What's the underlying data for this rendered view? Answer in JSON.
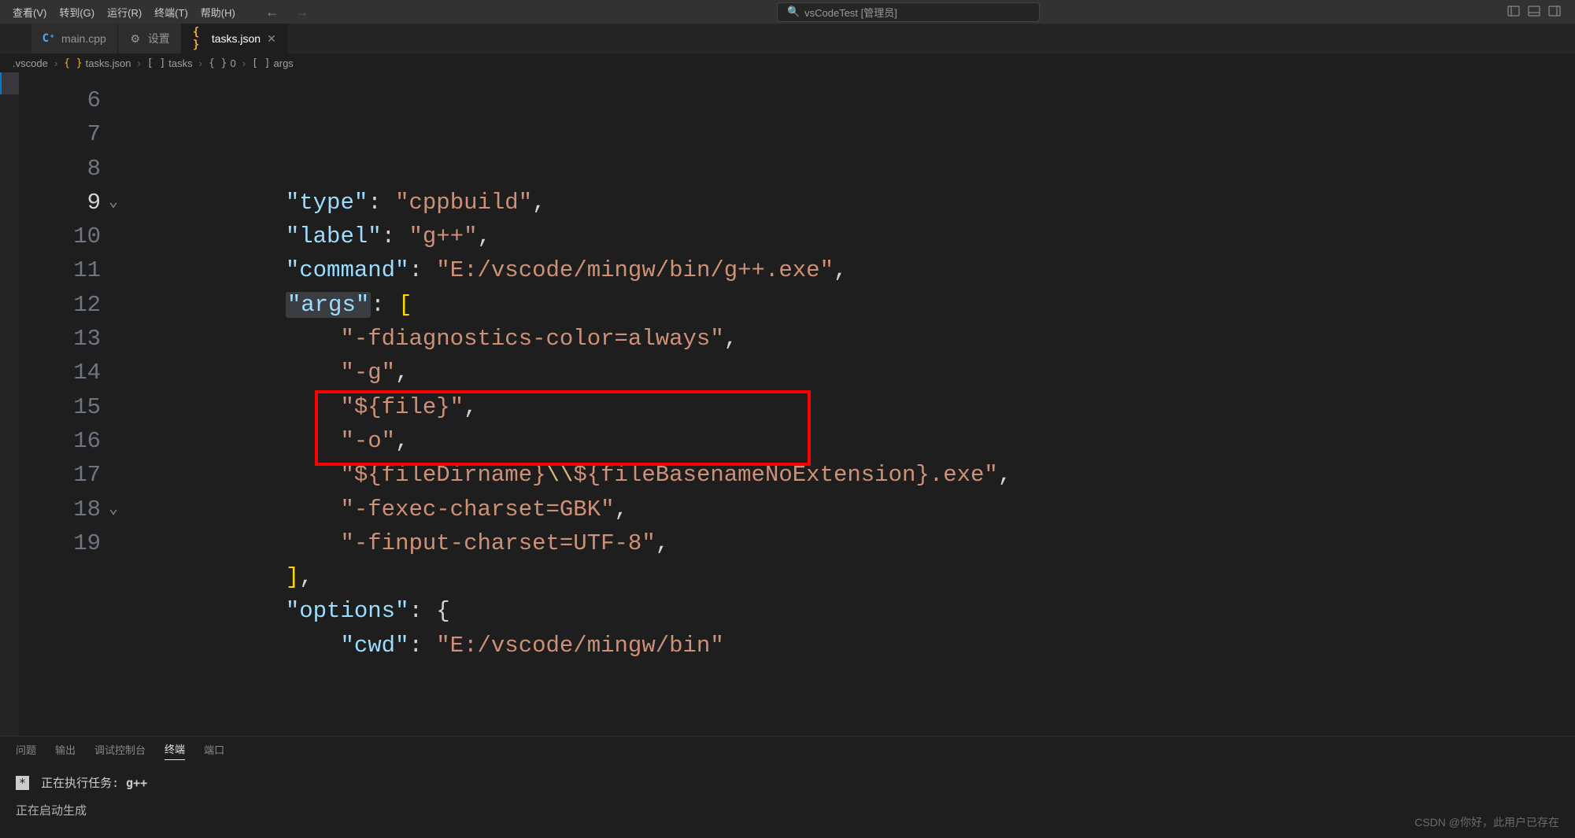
{
  "menubar": {
    "items": [
      "查看(V)",
      "转到(G)",
      "运行(R)",
      "终端(T)",
      "帮助(H)"
    ]
  },
  "search": {
    "placeholder": "vsCodeTest [管理员]"
  },
  "tabs": [
    {
      "icon": "cpp",
      "label": "main.cpp",
      "active": false
    },
    {
      "icon": "settings",
      "label": "设置",
      "active": false
    },
    {
      "icon": "brace",
      "label": "tasks.json",
      "active": true
    }
  ],
  "breadcrumb": {
    "parts": [
      {
        "label": ".vscode"
      },
      {
        "icon": "{ }",
        "label": "tasks.json"
      },
      {
        "icon": "[ ]",
        "label": "tasks"
      },
      {
        "icon": "{ }",
        "label": "0"
      },
      {
        "icon": "[ ]",
        "label": "args"
      }
    ]
  },
  "gutter": {
    "start": 6,
    "end": 19,
    "current": 9,
    "foldable": [
      9,
      18
    ]
  },
  "code": {
    "lines": [
      {
        "indent": 3,
        "key": "type",
        "colon": ": ",
        "str": "cppbuild",
        "tail": ","
      },
      {
        "indent": 3,
        "key": "label",
        "colon": ": ",
        "str": "g++",
        "tail": ","
      },
      {
        "indent": 3,
        "key": "command",
        "colon": ": ",
        "str": "E:/vscode/mingw/bin/g++.exe",
        "tail": ","
      },
      {
        "indent": 3,
        "key": "args",
        "key_hl": true,
        "colon": ": ",
        "bracket": "["
      },
      {
        "indent": 4,
        "str": "-fdiagnostics-color=always",
        "tail": ","
      },
      {
        "indent": 4,
        "str": "-g",
        "tail": ","
      },
      {
        "indent": 4,
        "str": "${file}",
        "tail": ","
      },
      {
        "indent": 4,
        "str": "-o",
        "tail": ","
      },
      {
        "indent": 4,
        "str_parts": [
          "${fileDirname}",
          "\\\\",
          "${fileBasenameNoExtension}.exe"
        ],
        "tail": ","
      },
      {
        "indent": 4,
        "str": "-fexec-charset=GBK",
        "tail": ","
      },
      {
        "indent": 4,
        "str": "-finput-charset=UTF-8",
        "tail": ","
      },
      {
        "indent": 3,
        "bracket": "]",
        "tail": ","
      },
      {
        "indent": 3,
        "key": "options",
        "colon": ": ",
        "brace": "{"
      },
      {
        "indent": 4,
        "key": "cwd",
        "colon": ": ",
        "str": "E:/vscode/mingw/bin"
      }
    ]
  },
  "panel": {
    "tabs": [
      "问题",
      "输出",
      "调试控制台",
      "终端",
      "端口"
    ],
    "active": "终端",
    "term_prefix": "*",
    "term_line1a": "正在执行任务: ",
    "term_line1b": "g++",
    "term_line2": "正在启动生成"
  },
  "watermark": "CSDN @你好，此用户已存在"
}
